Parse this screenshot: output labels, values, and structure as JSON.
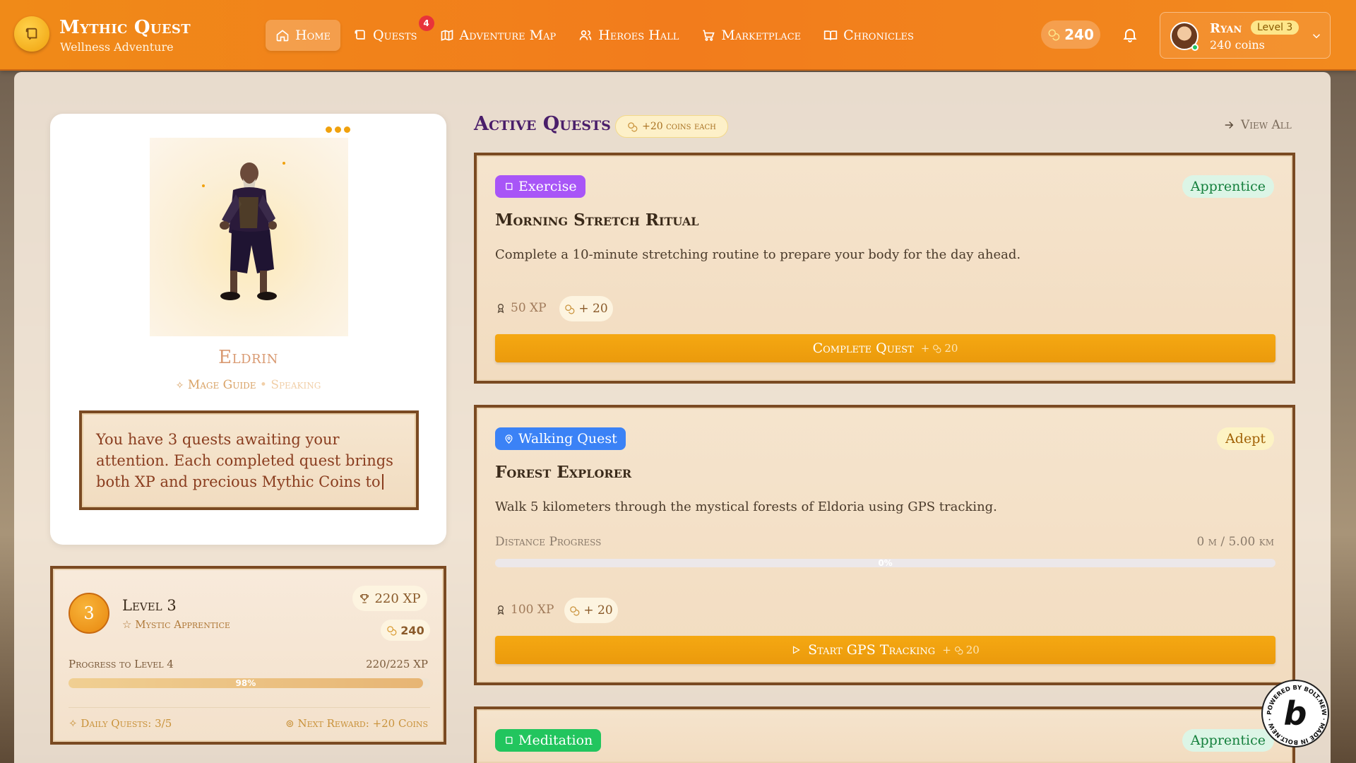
{
  "header": {
    "app_name": "Mythic Quest",
    "tagline": "Wellness Adventure",
    "nav": [
      {
        "label": "Home",
        "icon": "home-icon",
        "active": true
      },
      {
        "label": "Quests",
        "icon": "scroll-icon",
        "badge": "4"
      },
      {
        "label": "Adventure Map",
        "icon": "map-icon"
      },
      {
        "label": "Heroes Hall",
        "icon": "users-icon"
      },
      {
        "label": "Marketplace",
        "icon": "cart-icon"
      },
      {
        "label": "Chronicles",
        "icon": "book-icon"
      }
    ],
    "coins": "240",
    "user": {
      "name": "Ryan",
      "level": "Level 3",
      "coins": "240 coins"
    }
  },
  "guide": {
    "name": "Eldrin",
    "role": "Mage Guide",
    "status": "• Speaking",
    "speech": "You have 3 quests awaiting your attention. Each completed quest brings both XP and precious Mythic Coins to"
  },
  "level": {
    "number": "3",
    "title": "Level 3",
    "subtitle": "Mystic Apprentice",
    "xp": "220 XP",
    "coins": "240",
    "progress_label": "Progress to Level 4",
    "progress_value": "220/225 XP",
    "progress_percent": "98%",
    "progress_fraction": 0.98,
    "daily": "Daily Quests: 3/5",
    "next_reward": "Next Reward: +20 Coins"
  },
  "quests_section": {
    "title": "Active Quests",
    "coins_each": "+20 coins each",
    "view_all": "View All"
  },
  "quests": [
    {
      "category": "Exercise",
      "category_color": "#a855f7",
      "difficulty": "Apprentice",
      "title": "Morning Stretch Ritual",
      "description": "Complete a 10-minute stretching routine to prepare your body for the day ahead.",
      "xp": "50 XP",
      "coins": "+ 20",
      "button": "Complete Quest",
      "button_reward": "+",
      "button_coins": "20"
    },
    {
      "category": "Walking Quest",
      "category_color": "#3b82f6",
      "difficulty": "Adept",
      "title": "Forest Explorer",
      "description": "Walk 5 kilometers through the mystical forests of Eldoria using GPS tracking.",
      "distance_label": "Distance Progress",
      "distance_value": "0 m / 5.00 km",
      "distance_percent": "0%",
      "xp": "100 XP",
      "coins": "+ 20",
      "button": "Start GPS Tracking",
      "button_reward": "+",
      "button_coins": "20"
    },
    {
      "category": "Meditation",
      "category_color": "#22c55e",
      "difficulty": "Apprentice"
    }
  ],
  "badge": {
    "letter": "b",
    "text": "POWERED BY BOLT.NEW · MADE IN BOLT.NEW ·"
  }
}
